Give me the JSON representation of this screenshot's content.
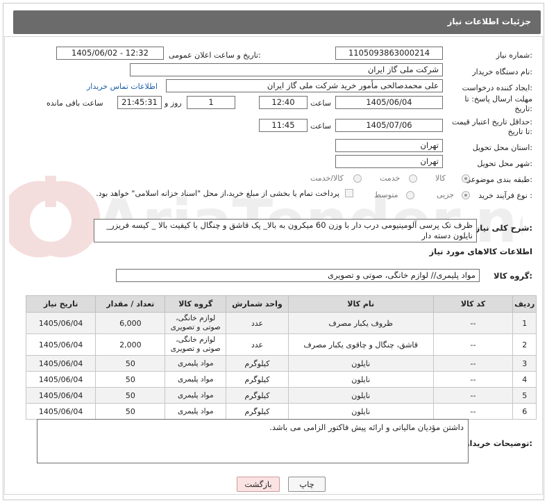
{
  "header": {
    "title": "جزئیات اطلاعات نیاز"
  },
  "form": {
    "need_number": {
      "label": "شماره نیاز:",
      "value": "1105093863000214"
    },
    "announce_datetime": {
      "label": "تاریخ و ساعت اعلان عمومی:",
      "value": "1405/06/02 - 12:32"
    },
    "buyer_org": {
      "label": "نام دستگاه خریدار:",
      "value": "شرکت ملی گاز ایران"
    },
    "requester": {
      "label": "ایجاد کننده درخواست:",
      "value": "علی محمدصالحی مأمور خرید شرکت ملی گاز ایران",
      "contact_link": "اطلاعات تماس خریدار"
    },
    "reply_deadline": {
      "label_line1": "مهلت ارسال پاسخ: تا",
      "label_line2": "تاریخ:",
      "date": "1405/06/04",
      "time_label": "ساعت",
      "time": "12:40",
      "days": "1",
      "days_label": "روز و",
      "remaining": "21:45:31",
      "remaining_label": "ساعت باقی مانده"
    },
    "price_validity": {
      "label_line1": "حداقل تاریخ اعتبار قیمت:",
      "label_line2": "تا تاریخ:",
      "date": "1405/07/06",
      "time_label": "ساعت",
      "time": "11:45"
    },
    "delivery_province": {
      "label": "استان محل تحویل:",
      "value": "تهران"
    },
    "delivery_city": {
      "label": "شهر محل تحویل:",
      "value": "تهران"
    },
    "category": {
      "label": "طبقه بندی موضوعی:",
      "options": [
        "کالا",
        "خدمت",
        "کالا/خدمت"
      ],
      "selected": "کالا"
    },
    "purchase_type": {
      "label": "نوع فرآیند خرید :",
      "options": [
        "جزیی",
        "متوسط"
      ],
      "selected": "جزیی",
      "payment_note": "پرداخت تمام یا بخشی از مبلغ خرید،از محل \"اسناد خزانه اسلامی\" خواهد بود."
    }
  },
  "description": {
    "label": "شرح کلی نیاز:",
    "value": "ظرف تک پرسی آلومینیومی درب دار با وزن 60 میکرون به بالا_ پک قاشق و چنگال با کیفیت بالا _ کیسه فریزر_ نایلون دسته دار"
  },
  "goods_info": {
    "title": "اطلاعات کالاهای مورد نیاز",
    "group_label": "گروه کالا:",
    "group_value": "مواد پلیمری// لوازم خانگی، صوتی و تصویری"
  },
  "table": {
    "headers": [
      "ردیف",
      "کد کالا",
      "نام کالا",
      "واحد شمارش",
      "گروه کالا",
      "تعداد / مقدار",
      "تاریخ نیاز"
    ],
    "rows": [
      [
        "1",
        "--",
        "ظروف یکبار مصرف",
        "عدد",
        "لوازم خانگی، صوتی و تصویری",
        "6,000",
        "1405/06/04"
      ],
      [
        "2",
        "--",
        "قاشق، چنگال و چاقوی یکبار مصرف",
        "عدد",
        "لوازم خانگی، صوتی و تصویری",
        "2,000",
        "1405/06/04"
      ],
      [
        "3",
        "--",
        "نایلون",
        "کیلوگرم",
        "مواد پلیمری",
        "50",
        "1405/06/04"
      ],
      [
        "4",
        "--",
        "نایلون",
        "کیلوگرم",
        "مواد پلیمری",
        "50",
        "1405/06/04"
      ],
      [
        "5",
        "--",
        "نایلون",
        "کیلوگرم",
        "مواد پلیمری",
        "50",
        "1405/06/04"
      ],
      [
        "6",
        "--",
        "نایلون",
        "کیلوگرم",
        "مواد پلیمری",
        "50",
        "1405/06/04"
      ]
    ]
  },
  "buyer_notes": {
    "label": "توضیحات خریدار:",
    "value": "داشتن مؤدیان مالیاتی و ارائه پیش فاکتور الزامی می باشد."
  },
  "buttons": {
    "print": "چاپ",
    "back": "بازگشت"
  },
  "watermark": {
    "text": "AriaTender.net"
  },
  "colors": {
    "header_bg": "#6b6b6b",
    "table_header_bg": "#dcdcdc",
    "back_button_bg": "#fbe3e3",
    "link": "#1a5fa8"
  }
}
